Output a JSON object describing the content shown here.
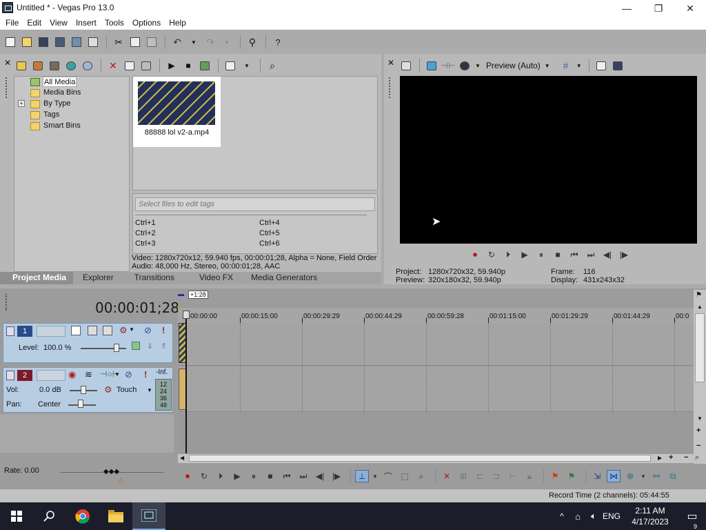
{
  "window": {
    "title": "Untitled * - Vegas Pro 13.0",
    "minimize": "—",
    "maximize": "❐",
    "close": "✕"
  },
  "menu": [
    "File",
    "Edit",
    "View",
    "Insert",
    "Tools",
    "Options",
    "Help"
  ],
  "project_media": {
    "tree": [
      {
        "label": "All Media",
        "selected": true
      },
      {
        "label": "Media Bins"
      },
      {
        "label": "By Type",
        "expander": "+"
      },
      {
        "label": "Tags"
      },
      {
        "label": "Smart Bins"
      }
    ],
    "file": {
      "name": "88888 lol v2-a.mp4"
    },
    "tag_placeholder": "Select files to edit tags",
    "shortcuts": [
      "Ctrl+1",
      "Ctrl+2",
      "Ctrl+3",
      "Ctrl+4",
      "Ctrl+5",
      "Ctrl+6"
    ],
    "info_video": "Video: 1280x720x12, 59.940 fps, 00:00:01;28, Alpha = None, Field Order",
    "info_audio": "Audio: 48,000 Hz, Stereo, 00:00:01;28, AAC"
  },
  "tabs": [
    "Project Media",
    "Explorer",
    "Transitions",
    "Video FX",
    "Media Generators"
  ],
  "preview": {
    "mode": "Preview (Auto)",
    "project_label": "Project:",
    "project_value": "1280x720x32, 59.940p",
    "preview_label": "Preview:",
    "preview_value": "320x180x32, 59.940p",
    "frame_label": "Frame:",
    "frame_value": "116",
    "display_label": "Display:",
    "display_value": "431x243x32"
  },
  "timeline": {
    "time": "00:00:01;28",
    "marker": "+1:28",
    "ruler": [
      "00:00:00",
      "00:00:15:00",
      "00:00:29:29",
      "00:00:44:29",
      "00:00:59:28",
      "00:01:15:00",
      "00:01:29:29",
      "00:01:44:29",
      "00:0"
    ],
    "track1": {
      "number": "1",
      "level_label": "Level:",
      "level_value": "100.0 %"
    },
    "track2": {
      "number": "2",
      "vol_label": "Vol:",
      "vol_value": "0.0 dB",
      "pan_label": "Pan:",
      "pan_value": "Center",
      "automation": "Touch",
      "meter_top": "-Inf.",
      "meter_scale": [
        "12",
        "24",
        "36",
        "48"
      ]
    },
    "rate": "Rate: 0.00"
  },
  "status": {
    "record_time": "Record Time (2 channels): 05:44:55"
  },
  "taskbar": {
    "language": "ENG",
    "time": "2:11 AM",
    "date": "4/17/2023",
    "notifications": "9"
  },
  "colors": {
    "accent_record": "#c0121a",
    "track_header": "#b7cde3"
  }
}
